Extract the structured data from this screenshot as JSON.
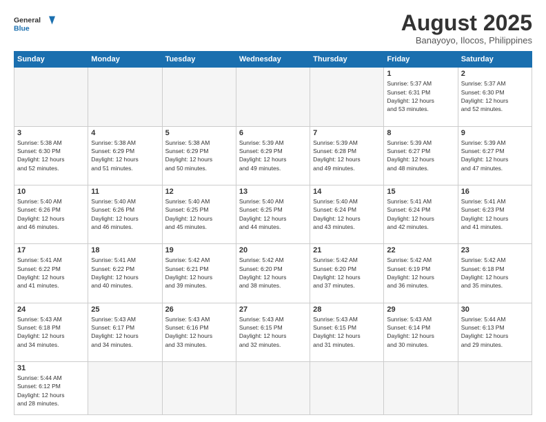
{
  "header": {
    "logo_general": "General",
    "logo_blue": "Blue",
    "title": "August 2025",
    "subtitle": "Banayoyo, Ilocos, Philippines"
  },
  "days_of_week": [
    "Sunday",
    "Monday",
    "Tuesday",
    "Wednesday",
    "Thursday",
    "Friday",
    "Saturday"
  ],
  "weeks": [
    [
      {
        "day": "",
        "info": ""
      },
      {
        "day": "",
        "info": ""
      },
      {
        "day": "",
        "info": ""
      },
      {
        "day": "",
        "info": ""
      },
      {
        "day": "",
        "info": ""
      },
      {
        "day": "1",
        "info": "Sunrise: 5:37 AM\nSunset: 6:31 PM\nDaylight: 12 hours\nand 53 minutes."
      },
      {
        "day": "2",
        "info": "Sunrise: 5:37 AM\nSunset: 6:30 PM\nDaylight: 12 hours\nand 52 minutes."
      }
    ],
    [
      {
        "day": "3",
        "info": "Sunrise: 5:38 AM\nSunset: 6:30 PM\nDaylight: 12 hours\nand 52 minutes."
      },
      {
        "day": "4",
        "info": "Sunrise: 5:38 AM\nSunset: 6:29 PM\nDaylight: 12 hours\nand 51 minutes."
      },
      {
        "day": "5",
        "info": "Sunrise: 5:38 AM\nSunset: 6:29 PM\nDaylight: 12 hours\nand 50 minutes."
      },
      {
        "day": "6",
        "info": "Sunrise: 5:39 AM\nSunset: 6:29 PM\nDaylight: 12 hours\nand 49 minutes."
      },
      {
        "day": "7",
        "info": "Sunrise: 5:39 AM\nSunset: 6:28 PM\nDaylight: 12 hours\nand 49 minutes."
      },
      {
        "day": "8",
        "info": "Sunrise: 5:39 AM\nSunset: 6:27 PM\nDaylight: 12 hours\nand 48 minutes."
      },
      {
        "day": "9",
        "info": "Sunrise: 5:39 AM\nSunset: 6:27 PM\nDaylight: 12 hours\nand 47 minutes."
      }
    ],
    [
      {
        "day": "10",
        "info": "Sunrise: 5:40 AM\nSunset: 6:26 PM\nDaylight: 12 hours\nand 46 minutes."
      },
      {
        "day": "11",
        "info": "Sunrise: 5:40 AM\nSunset: 6:26 PM\nDaylight: 12 hours\nand 46 minutes."
      },
      {
        "day": "12",
        "info": "Sunrise: 5:40 AM\nSunset: 6:25 PM\nDaylight: 12 hours\nand 45 minutes."
      },
      {
        "day": "13",
        "info": "Sunrise: 5:40 AM\nSunset: 6:25 PM\nDaylight: 12 hours\nand 44 minutes."
      },
      {
        "day": "14",
        "info": "Sunrise: 5:40 AM\nSunset: 6:24 PM\nDaylight: 12 hours\nand 43 minutes."
      },
      {
        "day": "15",
        "info": "Sunrise: 5:41 AM\nSunset: 6:24 PM\nDaylight: 12 hours\nand 42 minutes."
      },
      {
        "day": "16",
        "info": "Sunrise: 5:41 AM\nSunset: 6:23 PM\nDaylight: 12 hours\nand 41 minutes."
      }
    ],
    [
      {
        "day": "17",
        "info": "Sunrise: 5:41 AM\nSunset: 6:22 PM\nDaylight: 12 hours\nand 41 minutes."
      },
      {
        "day": "18",
        "info": "Sunrise: 5:41 AM\nSunset: 6:22 PM\nDaylight: 12 hours\nand 40 minutes."
      },
      {
        "day": "19",
        "info": "Sunrise: 5:42 AM\nSunset: 6:21 PM\nDaylight: 12 hours\nand 39 minutes."
      },
      {
        "day": "20",
        "info": "Sunrise: 5:42 AM\nSunset: 6:20 PM\nDaylight: 12 hours\nand 38 minutes."
      },
      {
        "day": "21",
        "info": "Sunrise: 5:42 AM\nSunset: 6:20 PM\nDaylight: 12 hours\nand 37 minutes."
      },
      {
        "day": "22",
        "info": "Sunrise: 5:42 AM\nSunset: 6:19 PM\nDaylight: 12 hours\nand 36 minutes."
      },
      {
        "day": "23",
        "info": "Sunrise: 5:42 AM\nSunset: 6:18 PM\nDaylight: 12 hours\nand 35 minutes."
      }
    ],
    [
      {
        "day": "24",
        "info": "Sunrise: 5:43 AM\nSunset: 6:18 PM\nDaylight: 12 hours\nand 34 minutes."
      },
      {
        "day": "25",
        "info": "Sunrise: 5:43 AM\nSunset: 6:17 PM\nDaylight: 12 hours\nand 34 minutes."
      },
      {
        "day": "26",
        "info": "Sunrise: 5:43 AM\nSunset: 6:16 PM\nDaylight: 12 hours\nand 33 minutes."
      },
      {
        "day": "27",
        "info": "Sunrise: 5:43 AM\nSunset: 6:15 PM\nDaylight: 12 hours\nand 32 minutes."
      },
      {
        "day": "28",
        "info": "Sunrise: 5:43 AM\nSunset: 6:15 PM\nDaylight: 12 hours\nand 31 minutes."
      },
      {
        "day": "29",
        "info": "Sunrise: 5:43 AM\nSunset: 6:14 PM\nDaylight: 12 hours\nand 30 minutes."
      },
      {
        "day": "30",
        "info": "Sunrise: 5:44 AM\nSunset: 6:13 PM\nDaylight: 12 hours\nand 29 minutes."
      }
    ],
    [
      {
        "day": "31",
        "info": "Sunrise: 5:44 AM\nSunset: 6:12 PM\nDaylight: 12 hours\nand 28 minutes."
      },
      {
        "day": "",
        "info": ""
      },
      {
        "day": "",
        "info": ""
      },
      {
        "day": "",
        "info": ""
      },
      {
        "day": "",
        "info": ""
      },
      {
        "day": "",
        "info": ""
      },
      {
        "day": "",
        "info": ""
      }
    ]
  ]
}
